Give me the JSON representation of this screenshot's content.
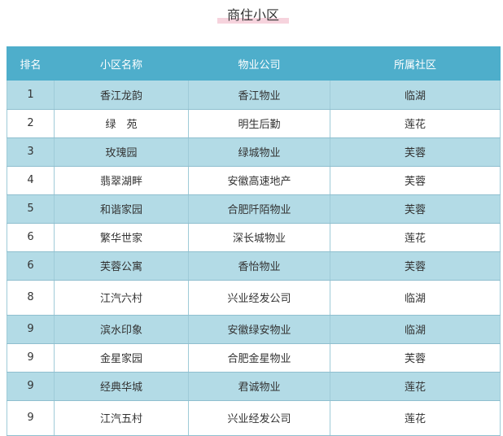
{
  "title": "商住小区",
  "table": {
    "headers": [
      "排名",
      "小区名称",
      "物业公司",
      "所属社区"
    ],
    "rows": [
      [
        "1",
        "香江龙韵",
        "香江物业",
        "临湖"
      ],
      [
        "2",
        "绿　苑",
        "明生后勤",
        "莲花"
      ],
      [
        "3",
        "玫瑰园",
        "绿城物业",
        "芙蓉"
      ],
      [
        "4",
        "翡翠湖畔",
        "安徽高速地产",
        "芙蓉"
      ],
      [
        "5",
        "和谐家园",
        "合肥阡陌物业",
        "芙蓉"
      ],
      [
        "6",
        "繁华世家",
        "深长城物业",
        "莲花"
      ],
      [
        "6",
        "芙蓉公寓",
        "香怡物业",
        "芙蓉"
      ],
      [
        "8",
        "江汽六村",
        "兴业经发公司",
        "临湖"
      ],
      [
        "9",
        "滨水印象",
        "安徽绿安物业",
        "临湖"
      ],
      [
        "9",
        "金星家园",
        "合肥金星物业",
        "芙蓉"
      ],
      [
        "9",
        "经典华城",
        "君诚物业",
        "莲花"
      ],
      [
        "9",
        "江汽五村",
        "兴业经发公司",
        "莲花"
      ]
    ]
  }
}
